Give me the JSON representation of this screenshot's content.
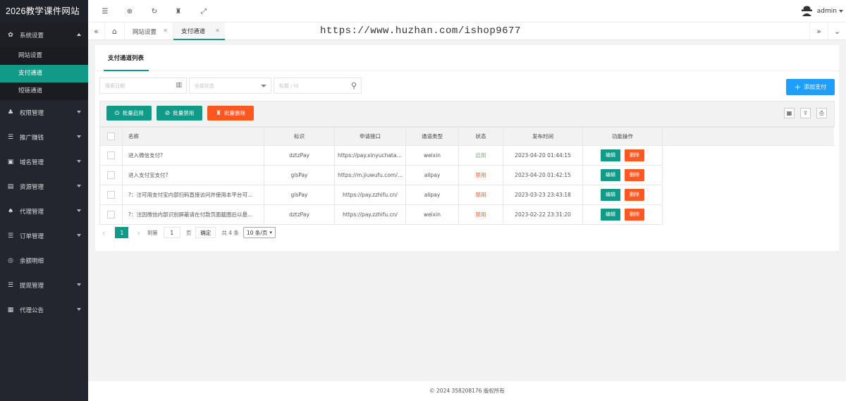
{
  "app": {
    "title": "2026教学课件网站"
  },
  "sidebar": {
    "menus": [
      {
        "label": "系统设置",
        "icon": "gear-icon",
        "open": true,
        "children": [
          {
            "label": "网站设置"
          },
          {
            "label": "支付通道",
            "active": true
          },
          {
            "label": "短链通道"
          }
        ]
      },
      {
        "label": "权限管理",
        "icon": "users-icon"
      },
      {
        "label": "推广赚钱",
        "icon": "list-icon"
      },
      {
        "label": "域名管理",
        "icon": "domain-icon"
      },
      {
        "label": "资源管理",
        "icon": "box-icon"
      },
      {
        "label": "代理管理",
        "icon": "cubes-icon"
      },
      {
        "label": "订单管理",
        "icon": "list-icon"
      },
      {
        "label": "余额明细",
        "icon": "dollar-icon"
      },
      {
        "label": "提现管理",
        "icon": "list-icon"
      },
      {
        "label": "代理公告",
        "icon": "grid-icon"
      }
    ]
  },
  "header": {
    "user": "admin"
  },
  "tabs": [
    {
      "label": "网站设置"
    },
    {
      "label": "支付通道",
      "active": true
    }
  ],
  "watermark": "https://www.huzhan.com/ishop9677",
  "panel": {
    "title": "支付通道列表",
    "search": {
      "date_placeholder": "搜索日期",
      "status_placeholder": "全部状态",
      "keyword_placeholder": "标题 / id"
    },
    "add_label": "添加支付",
    "batch": {
      "enable": "批量启用",
      "disable": "批量禁用",
      "delete": "批量删除"
    },
    "table": {
      "headers": [
        "名称",
        "标识",
        "申请接口",
        "通道类型",
        "状态",
        "发布时间",
        "功能操作"
      ],
      "rows": [
        {
          "name": "进入微信支付?",
          "code": "dztzPay",
          "api": "https://pay.xinyuchatai...",
          "type": "weixin",
          "status": "启用",
          "enabled": true,
          "time": "2023-04-20 01:44:15"
        },
        {
          "name": "进入支付宝支付?",
          "code": "glsPay",
          "api": "https://m.jiuwufu.com/...",
          "type": "alipay",
          "status": "禁用",
          "enabled": false,
          "time": "2023-04-20 01:42:15"
        },
        {
          "name": "?：注可用支付宝内部扫码直接访问并使用本平台可...",
          "code": "glsPay",
          "api": "https://pay.zzhifu.cn/",
          "type": "alipay",
          "status": "禁用",
          "enabled": false,
          "time": "2023-03-23 23:43:18"
        },
        {
          "name": "?：注因微信内部识别屏蔽请在付款页面截图后以悬...",
          "code": "dztzPay",
          "api": "https://pay.zzhifu.cn/",
          "type": "weixin",
          "status": "禁用",
          "enabled": false,
          "time": "2023-02-22 23:31:20"
        }
      ],
      "edit_label": "编辑",
      "delete_label": "删除"
    },
    "pager": {
      "current": "1",
      "goto_label": "到第",
      "goto_value": "1",
      "page_unit": "页",
      "confirm_label": "确定",
      "total_label": "共 4 条",
      "page_size": "10 条/页"
    }
  },
  "footer": {
    "text": "© 2024 358208176 版权所有"
  },
  "colors": {
    "accent": "#119a87",
    "blue": "#1e9fff",
    "danger": "#ff5722",
    "success": "#5fb878",
    "sidebar": "#23262e"
  }
}
